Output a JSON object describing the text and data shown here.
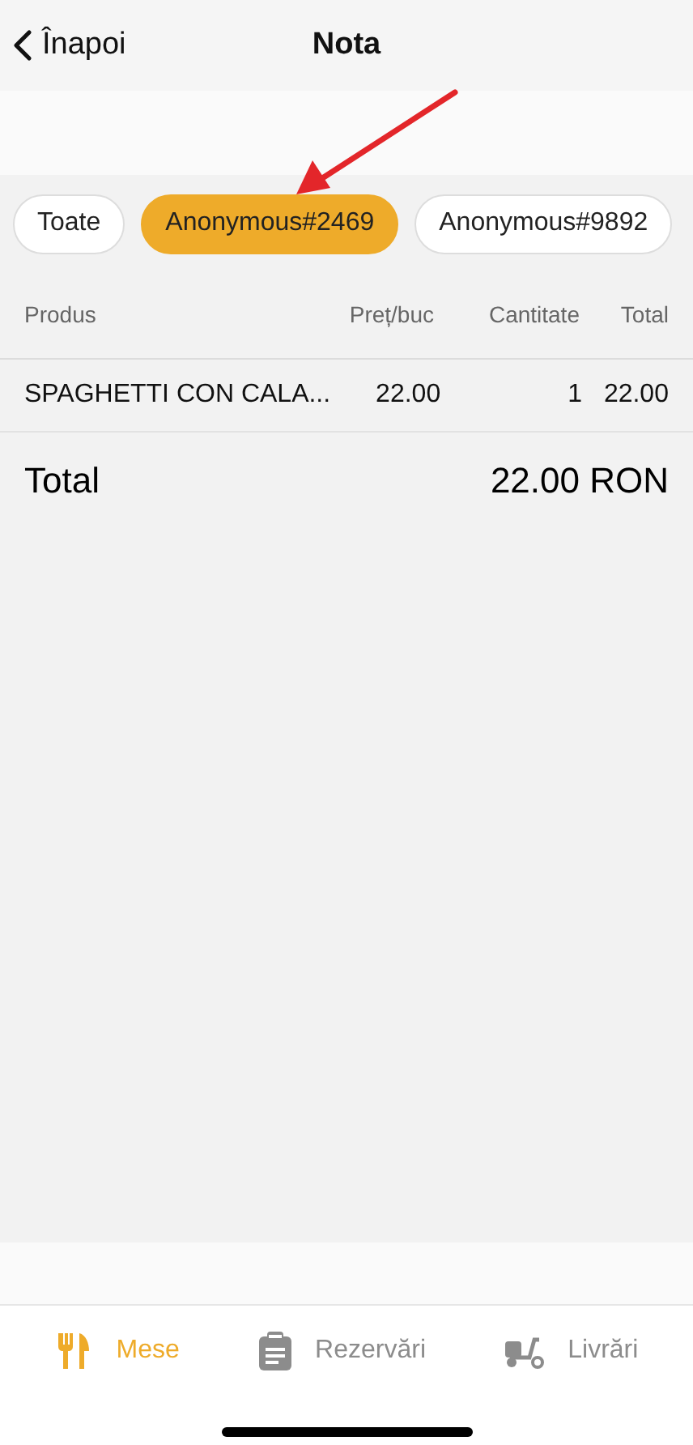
{
  "nav": {
    "back_label": "Înapoi",
    "title": "Nota"
  },
  "filters": [
    {
      "label": "Toate",
      "selected": false
    },
    {
      "label": "Anonymous#2469",
      "selected": true
    },
    {
      "label": "Anonymous#9892",
      "selected": false
    }
  ],
  "table": {
    "columns": [
      "Produs",
      "Preț/buc",
      "Cantitate",
      "Total"
    ],
    "rows": [
      [
        "SPAGHETTI CON CALA...",
        "22.00",
        "1",
        "22.00"
      ]
    ]
  },
  "total": {
    "label": "Total",
    "value": "22.00 RON"
  },
  "tab_bar": [
    {
      "kind": "meals",
      "label": "Mese",
      "selected": true
    },
    {
      "kind": "reservations",
      "label": "Rezervări",
      "selected": false
    },
    {
      "kind": "delivery",
      "label": "Livrări",
      "selected": false
    }
  ]
}
